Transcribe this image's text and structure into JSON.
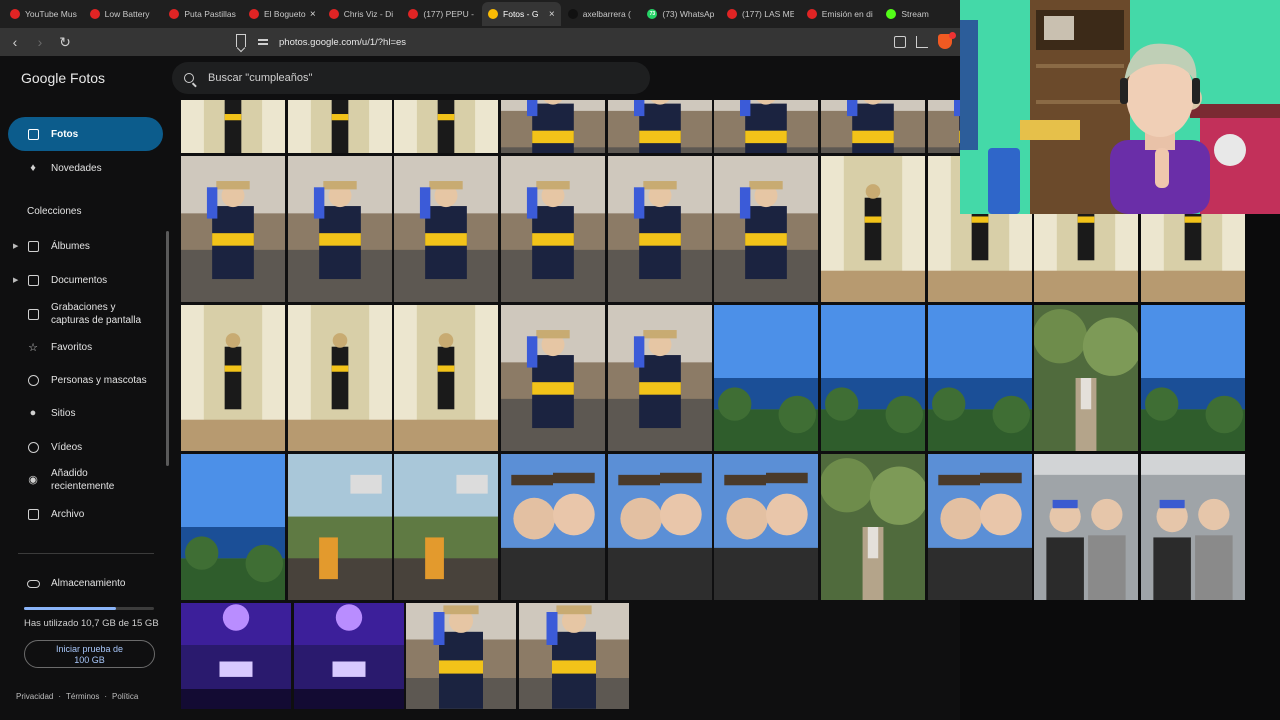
{
  "browser": {
    "tabs": [
      {
        "label": "YouTube Mus",
        "icon": "youtube-icon",
        "color": "#e02424"
      },
      {
        "label": "Low Battery",
        "icon": "youtube-icon",
        "color": "#e02424"
      },
      {
        "label": "Puta Pastillas",
        "icon": "youtube-icon",
        "color": "#e02424"
      },
      {
        "label": "El Bogueto",
        "icon": "youtube-icon",
        "color": "#e02424"
      },
      {
        "label": "Chris Viz - Di",
        "icon": "youtube-icon",
        "color": "#e02424"
      },
      {
        "label": "(177) PEPU -",
        "icon": "youtube-icon",
        "color": "#e02424"
      },
      {
        "label": "Fotos - G",
        "icon": "google-photos-icon",
        "color": "#fbbc04",
        "active": true
      },
      {
        "label": "axelbarrera (",
        "icon": "tiktok-icon",
        "color": "#111111"
      },
      {
        "label": "(73) WhatsAp",
        "icon": "whatsapp-icon",
        "color": "#25d366",
        "badge": "73"
      },
      {
        "label": "(177) LAS ME",
        "icon": "youtube-icon",
        "color": "#e02424"
      },
      {
        "label": "Emisión en di",
        "icon": "youtube-icon",
        "color": "#e02424"
      },
      {
        "label": "Stream",
        "icon": "kick-icon",
        "color": "#53fc18"
      }
    ],
    "url": "photos.google.com/u/1/?hl=es"
  },
  "app": {
    "logo_brand": "Google",
    "logo_product": "Fotos",
    "search_placeholder": "Buscar \"cumpleaños\"",
    "nav": {
      "photos": "Fotos",
      "updates": "Novedades",
      "collections": "Colecciones",
      "albums": "Álbumes",
      "documents": "Documentos",
      "recordings_1": "Grabaciones y",
      "recordings_2": "capturas de pantalla",
      "favorites": "Favoritos",
      "people": "Personas y mascotas",
      "places": "Sitios",
      "videos": "Vídeos",
      "recent_1": "Añadido",
      "recent_2": "recientemente",
      "archive": "Archivo"
    },
    "storage": {
      "label": "Almacenamiento",
      "used_text": "Has utilizado 10,7 GB de 15 GB",
      "used_fraction": 0.71,
      "trial_1": "Iniciar prueba de",
      "trial_2": "100 GB"
    },
    "footer": {
      "privacy": "Privacidad",
      "terms": "Términos",
      "policy": "Política"
    }
  },
  "photos": [
    "room-selfie",
    "room-selfie",
    "room-selfie",
    "room-selfie",
    "room-selfie",
    "room-selfie",
    "hallway",
    "hallway",
    "hallway",
    "hallway",
    "hallway",
    "hallway",
    "hallway",
    "room-selfie",
    "room-selfie",
    "lake",
    "lake",
    "lake",
    "forest",
    "lake",
    "lake",
    "chairlift",
    "chairlift",
    "friends",
    "friends",
    "friends",
    "forest",
    "friends",
    "elevator",
    "elevator",
    "concert",
    "concert"
  ]
}
